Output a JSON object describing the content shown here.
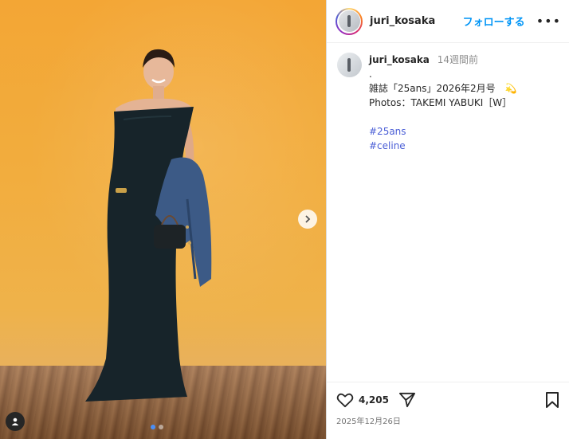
{
  "post": {
    "username": "juri_kosaka",
    "follow_label": "フォローする",
    "more_label": "•••",
    "caption": {
      "username": "juri_kosaka",
      "time": "14週間前",
      "line_dot": ".",
      "line_magazine": "雑誌「25ans」2026年2月号",
      "magazine_emoji": "💫",
      "line_photos": "Photos：TAKEMI YABUKI［W］",
      "hashtags": [
        "#25ans",
        "#celine"
      ]
    },
    "likes": "4,205",
    "date": "2025年12月26日",
    "carousel": {
      "current": 1,
      "total": 2
    }
  },
  "colors": {
    "accent": "#0095f6",
    "hashtag": "#4a5ed6",
    "backdrop": "#f3a635"
  },
  "icons": [
    "more-icon",
    "heart-icon",
    "share-icon",
    "bookmark-icon",
    "chevron-right-icon",
    "user-tag-icon"
  ]
}
